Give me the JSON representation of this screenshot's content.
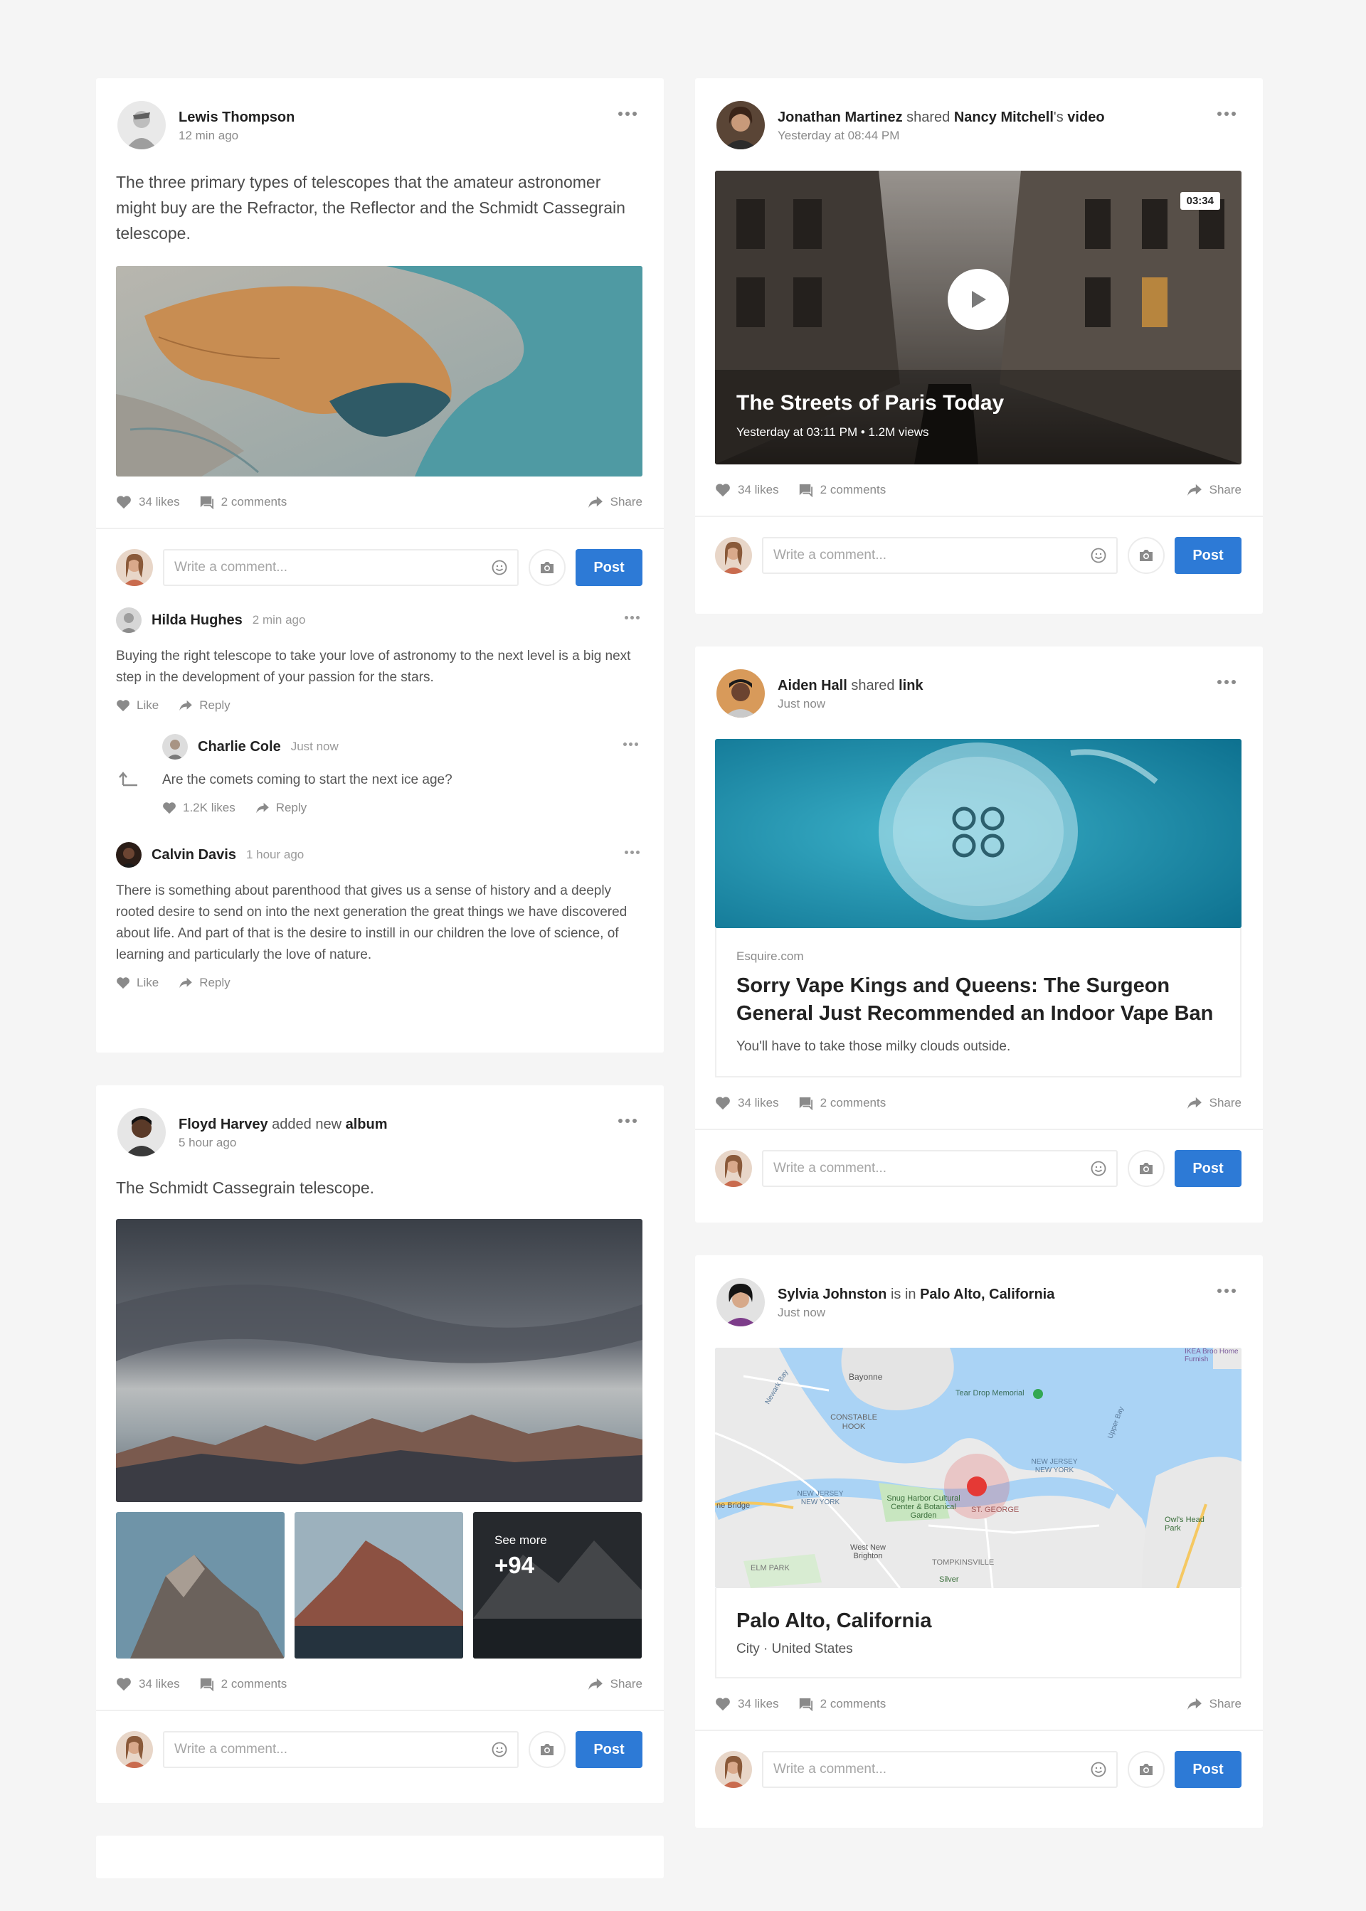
{
  "posts": {
    "lewis": {
      "author": "Lewis Thompson",
      "time": "12 min ago",
      "text": "The three primary types of telescopes that the amateur astronomer might buy are the Refractor, the Reflector and the Schmidt Cassegrain telescope.",
      "likes": "34 likes",
      "comments": "2 comments",
      "share": "Share"
    },
    "jonathan": {
      "author": "Jonathan Martinez",
      "verb": "shared",
      "target": "Nancy Mitchell",
      "possessive": "'s",
      "object": "video",
      "time": "Yesterday at 08:44 PM",
      "video_duration": "03:34",
      "video_title": "The Streets of Paris Today",
      "video_meta": "Yesterday at 03:11 PM • 1.2M views",
      "likes": "34 likes",
      "comments": "2 comments",
      "share": "Share"
    },
    "aiden": {
      "author": "Aiden Hall",
      "verb": "shared",
      "object": "link",
      "time": "Just now",
      "link_domain": "Esquire.com",
      "link_title": "Sorry Vape Kings and Queens: The Surgeon General Just Recommended an Indoor Vape Ban",
      "link_desc": "You'll have to take those milky clouds outside.",
      "likes": "34 likes",
      "comments": "2 comments",
      "share": "Share"
    },
    "floyd": {
      "author": "Floyd Harvey",
      "verb": "added new",
      "object": "album",
      "time": "5 hour ago",
      "text": "The Schmidt Cassegrain telescope.",
      "see_more": "See more",
      "see_more_count": "+94",
      "likes": "34 likes",
      "comments": "2 comments",
      "share": "Share"
    },
    "sylvia": {
      "author": "Sylvia Johnston",
      "verb": "is in",
      "place": "Palo Alto, California",
      "time": "Just now",
      "place_title": "Palo Alto, California",
      "place_sub": "City · United States",
      "likes": "34 likes",
      "comments": "2 comments",
      "share": "Share"
    }
  },
  "map_labels": {
    "bayonne": "Bayonne",
    "constable": "CONSTABLE HOOK",
    "teardrop": "Tear Drop Memorial",
    "nj_ny": "NEW JERSEY NEW YORK",
    "nj_ny_right": "NEW JERSEY NEW YORK",
    "snug": "Snug Harbor Cultural Center & Botanical Garden",
    "st_george": "ST. GEORGE",
    "westnew": "West New Brighton",
    "tompkins": "TOMPKINSVILLE",
    "elmpark": "ELM PARK",
    "owls": "Owl's Head Park",
    "ikea": "IKEA Broo Home Furnish",
    "bridge": "ne Bridge",
    "upper_bay": "Upper Bay",
    "newark_bay": "Newark Bay",
    "silver": "Silver"
  },
  "comments": [
    {
      "name": "Hilda Hughes",
      "time": "2 min ago",
      "text": "Buying the right telescope to take your love of astronomy to the next level is a big next step in the development of your passion for the stars.",
      "like": "Like",
      "reply": "Reply"
    },
    {
      "name": "Charlie Cole",
      "time": "Just now",
      "text": "Are the comets coming to start the next ice age?",
      "likes": "1.2K likes",
      "reply": "Reply"
    },
    {
      "name": "Calvin Davis",
      "time": "1 hour ago",
      "text": "There is something about parenthood that gives us a sense of history and a deeply rooted desire to send on into the next generation the great things we have discovered about life. And part of that is the desire to instill in our children the love of science, of learning and particularly the love of nature.",
      "like": "Like",
      "reply": "Reply"
    }
  ],
  "comment_bar": {
    "placeholder": "Write a comment...",
    "post_label": "Post"
  },
  "colors": {
    "accent": "#2d7ad6",
    "pin": "#e53935"
  }
}
